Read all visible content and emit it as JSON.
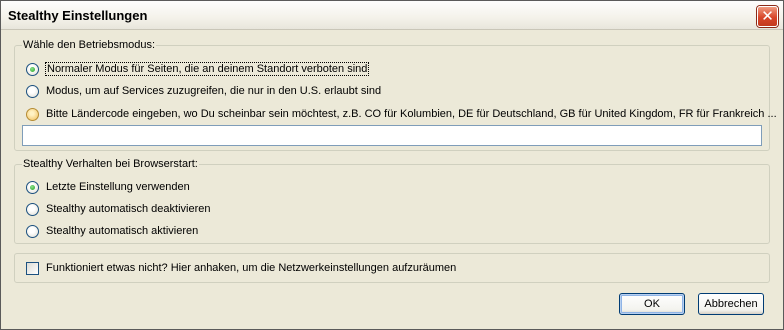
{
  "window": {
    "title": "Stealthy Einstellungen",
    "close_glyph": "✕"
  },
  "mode_group": {
    "legend": "Wähle den Betriebsmodus:",
    "options": [
      {
        "label": "Normaler Modus für Seiten, die an deinem Standort verboten sind",
        "checked": true
      },
      {
        "label": "Modus, um auf Services zuzugreifen, die nur in den U.S. erlaubt sind",
        "checked": false
      },
      {
        "label": "Bitte Ländercode eingeben, wo Du scheinbar sein möchtest, z.B. CO für Kolumbien, DE für Deutschland, GB für United Kingdom, FR für Frankreich ...",
        "checked": false
      }
    ],
    "country_code_value": ""
  },
  "startup_group": {
    "legend": "Stealthy Verhalten bei Browserstart:",
    "options": [
      {
        "label": "Letzte Einstellung verwenden",
        "checked": true
      },
      {
        "label": "Stealthy automatisch deaktivieren",
        "checked": false
      },
      {
        "label": "Stealthy automatisch aktivieren",
        "checked": false
      }
    ]
  },
  "reset_group": {
    "checkbox_label": "Funktioniert etwas nicht? Hier anhaken, um die Netzwerkeinstellungen aufzuräumen",
    "checked": false
  },
  "buttons": {
    "ok": "OK",
    "cancel": "Abbrechen"
  },
  "icons": {
    "close": "close-icon"
  }
}
